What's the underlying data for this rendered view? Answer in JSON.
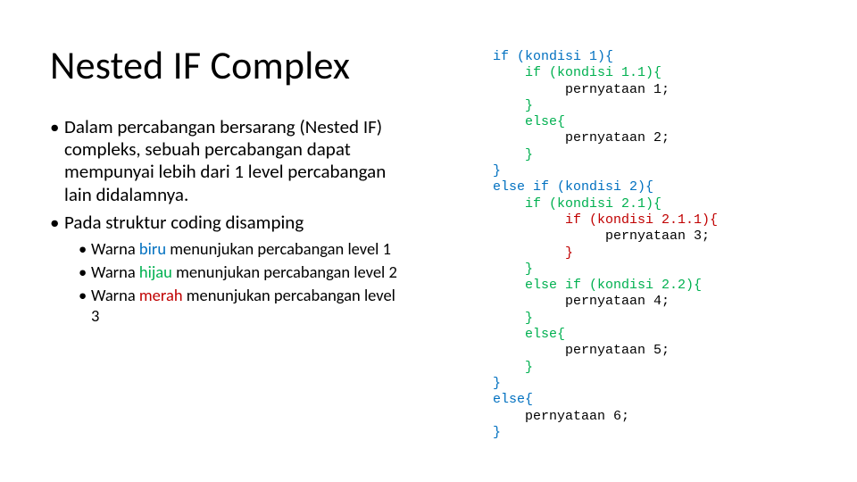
{
  "title": "Nested IF Complex",
  "bullets": {
    "p1": "Dalam percabangan bersarang (Nested IF) compleks, sebuah percabangan dapat mempunyai lebih dari 1 level percabangan lain didalamnya.",
    "p2": "Pada struktur coding disamping",
    "s1a": "Warna ",
    "s1c": "biru",
    "s1b": " menunjukan percabangan level 1",
    "s2a": " Warna ",
    "s2c": "hijau",
    "s2b": " menunjukan percabangan level 2",
    "s3a": "Warna ",
    "s3c": "merah",
    "s3b": " menunjukan percabangan level 3"
  },
  "code": {
    "l01": "if (kondisi 1){",
    "l02": "    if (kondisi 1.1){",
    "l03": "         pernyataan 1;",
    "l04": "    }",
    "l05": "    else{",
    "l06": "         pernyataan 2;",
    "l07": "    }",
    "l08": "}",
    "l09": "else if (kondisi 2){",
    "l10": "    if (kondisi 2.1){",
    "l11": "         if (kondisi 2.1.1){",
    "l12": "              pernyataan 3;",
    "l13": "         }",
    "l14": "    }",
    "l15": "    else if (kondisi 2.2){",
    "l16": "         pernyataan 4;",
    "l17": "    }",
    "l18": "    else{",
    "l19": "         pernyataan 5;",
    "l20": "    }",
    "l21": "}",
    "l22": "else{",
    "l23": "    pernyataan 6;",
    "l24": "}"
  },
  "colors": {
    "blue": "#0070C0",
    "green": "#00B050",
    "red": "#C00000"
  }
}
